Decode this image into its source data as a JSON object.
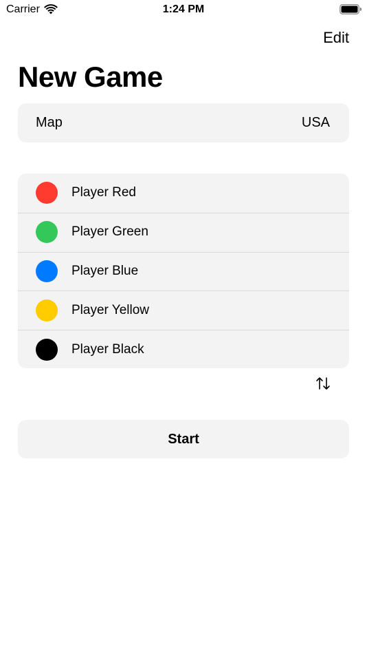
{
  "status": {
    "carrier": "Carrier",
    "time": "1:24 PM",
    "icons": [
      "wifi-icon",
      "battery-icon"
    ]
  },
  "nav": {
    "edit_label": "Edit",
    "title": "New Game"
  },
  "map": {
    "label": "Map",
    "value": "USA"
  },
  "players": [
    {
      "name": "Player Red",
      "color": "#ff3b30"
    },
    {
      "name": "Player Green",
      "color": "#34c759"
    },
    {
      "name": "Player Blue",
      "color": "#007aff"
    },
    {
      "name": "Player Yellow",
      "color": "#ffcc00"
    },
    {
      "name": "Player Black",
      "color": "#000000"
    }
  ],
  "sort_icon": "swap-vertical-icon",
  "start_label": "Start"
}
